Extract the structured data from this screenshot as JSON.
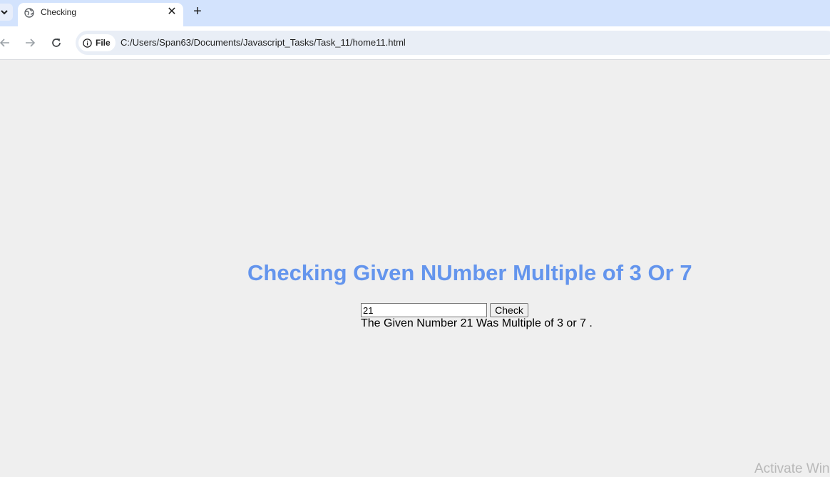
{
  "browser": {
    "tab": {
      "title": "Checking",
      "icon": "globe-icon",
      "close_label": "✕"
    },
    "new_tab_label": "+",
    "tab_menu_icon": "chevron-down-icon",
    "address_bar": {
      "site_chip_label": "File",
      "url": "C:/Users/Span63/Documents/Javascript_Tasks/Task_11/home11.html"
    }
  },
  "page": {
    "heading": "Checking Given NUmber Multiple of 3 Or 7",
    "heading_color": "#6495ed",
    "number_input_value": "21",
    "check_button_label": "Check",
    "result_text": "The Given Number 21 Was Multiple of 3 or 7 ."
  },
  "os_watermark": "Activate Windows"
}
